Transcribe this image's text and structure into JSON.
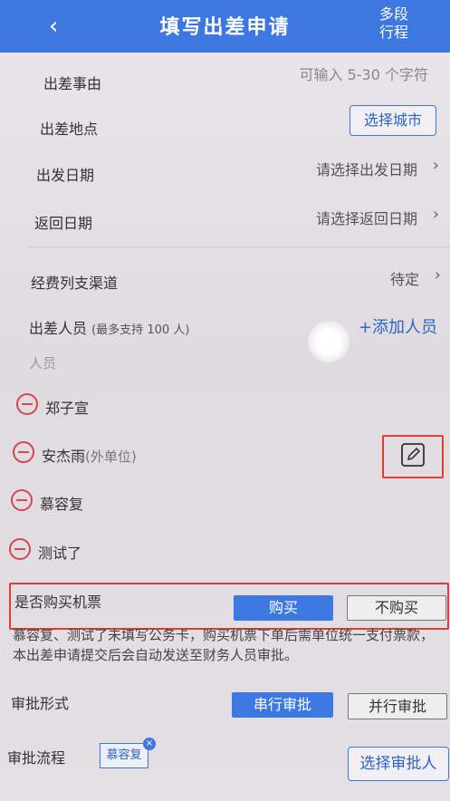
{
  "header": {
    "back_icon": "‹",
    "title": "填写出差申请",
    "multi_line1": "多段",
    "multi_line2": "行程",
    "bg_color": "#3c78e0"
  },
  "form": {
    "reason_label": "出差事由",
    "reason_placeholder": "可输入 5-30 个字符",
    "location_label": "出差地点",
    "location_button": "选择城市",
    "depart_label": "出发日期",
    "depart_value": "请选择出发日期",
    "return_label": "返回日期",
    "return_value": "请选择返回日期",
    "channel_label": "经费列支渠道",
    "channel_value": "待定",
    "travelers_label": "出差人员",
    "travelers_hint": "(最多支持 100 人)",
    "add_person": "+添加人员",
    "people_section": "人员",
    "people": [
      {
        "name": "郑子宣",
        "note": ""
      },
      {
        "name": "安杰雨",
        "note": "(外单位)"
      },
      {
        "name": "慕容复",
        "note": ""
      },
      {
        "name": "测试了",
        "note": ""
      }
    ],
    "ticket_label": "是否购买机票",
    "ticket_buy": "购买",
    "ticket_no_buy": "不购买",
    "ticket_note": "慕容复、测试了未填写公务卡，购买机票下单后需单位统一支付票款，本出差申请提交后会自动发送至财务人员审批。",
    "approval_form_label": "审批形式",
    "approval_serial": "串行审批",
    "approval_parallel": "并行审批",
    "approval_flow_label": "审批流程",
    "approver_chip": "慕容复",
    "select_approver": "选择审批人"
  },
  "icons": {
    "chevron": "›",
    "edit": "edit-icon",
    "remove": "minus-circle-icon",
    "chip_close": "×"
  },
  "colors": {
    "accent": "#3c78e0",
    "remove_red": "#d5464e",
    "highlight_red": "#e53935"
  }
}
